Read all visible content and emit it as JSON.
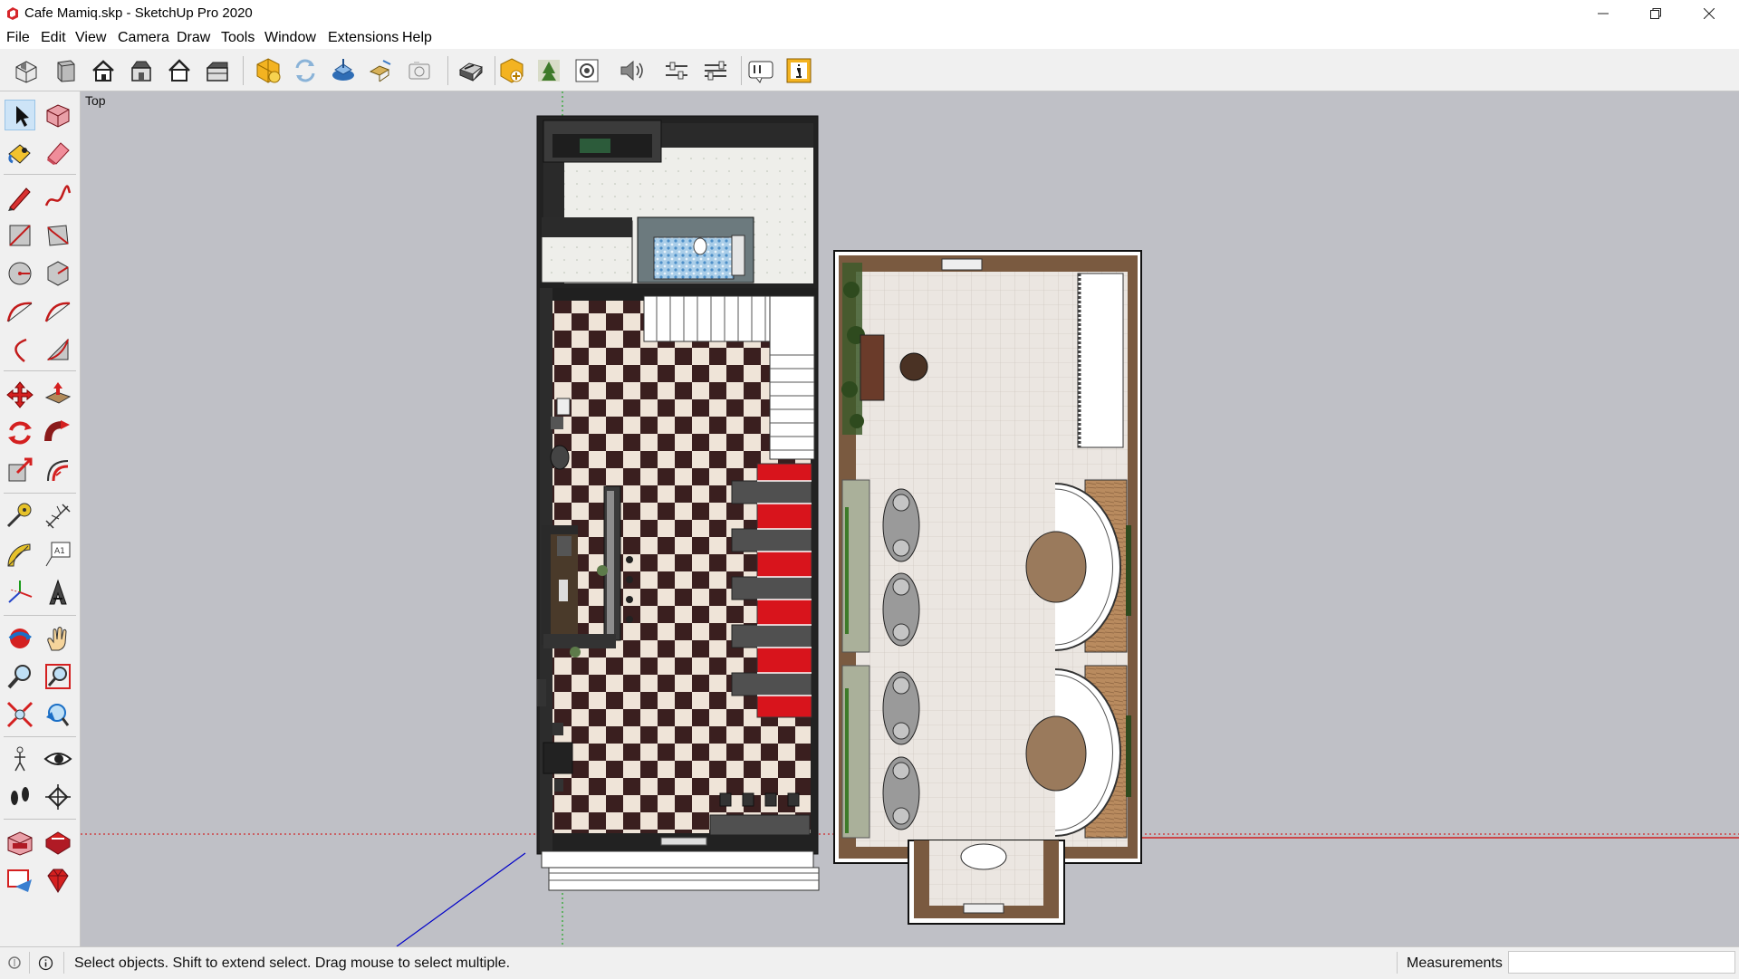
{
  "window": {
    "title": "Cafe Mamiq.skp - SketchUp Pro 2020"
  },
  "menu": [
    "File",
    "Edit",
    "View",
    "Camera",
    "Draw",
    "Tools",
    "Window",
    "Extensions",
    "Help"
  ],
  "viewport": {
    "view_label": "Top"
  },
  "status": {
    "hint": "Select objects. Shift to extend select. Drag mouse to select multiple.",
    "measurements_label": "Measurements",
    "measurements_value": ""
  },
  "colors": {
    "axis_red": "#d40000",
    "axis_green": "#00a000",
    "axis_blue": "#0000c8",
    "selection_blue": "#cde4f7",
    "floor_checker_dark": "#3a1f1f",
    "floor_checker_light": "#efe4d8",
    "sofa_red": "#d8141c"
  }
}
